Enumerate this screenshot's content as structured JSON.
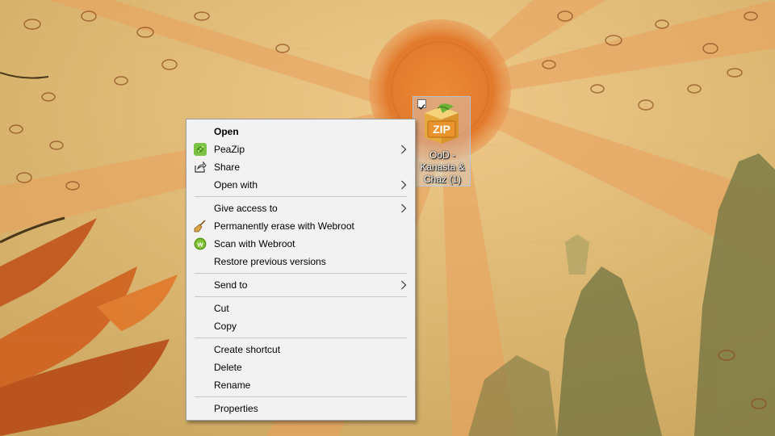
{
  "desktop": {
    "icon": {
      "label": "OoD - Kanasta & Chaz (1)",
      "badge_text": "ZIP",
      "checked": true
    }
  },
  "context_menu": {
    "items": [
      {
        "label": "Open"
      },
      {
        "label": "PeaZip"
      },
      {
        "label": "Share"
      },
      {
        "label": "Open with"
      },
      {
        "label": "Give access to"
      },
      {
        "label": "Permanently erase with Webroot"
      },
      {
        "label": "Scan with Webroot"
      },
      {
        "label": "Restore previous versions"
      },
      {
        "label": "Send to"
      },
      {
        "label": "Cut"
      },
      {
        "label": "Copy"
      },
      {
        "label": "Create shortcut"
      },
      {
        "label": "Delete"
      },
      {
        "label": "Rename"
      },
      {
        "label": "Properties"
      }
    ]
  },
  "colors": {
    "wallpaper_base": "#d9b56a",
    "sun": "#e07a2a",
    "menu_bg": "#f2f2f2",
    "peazip_green": "#7cc243",
    "webroot_green": "#5a9a1e"
  }
}
